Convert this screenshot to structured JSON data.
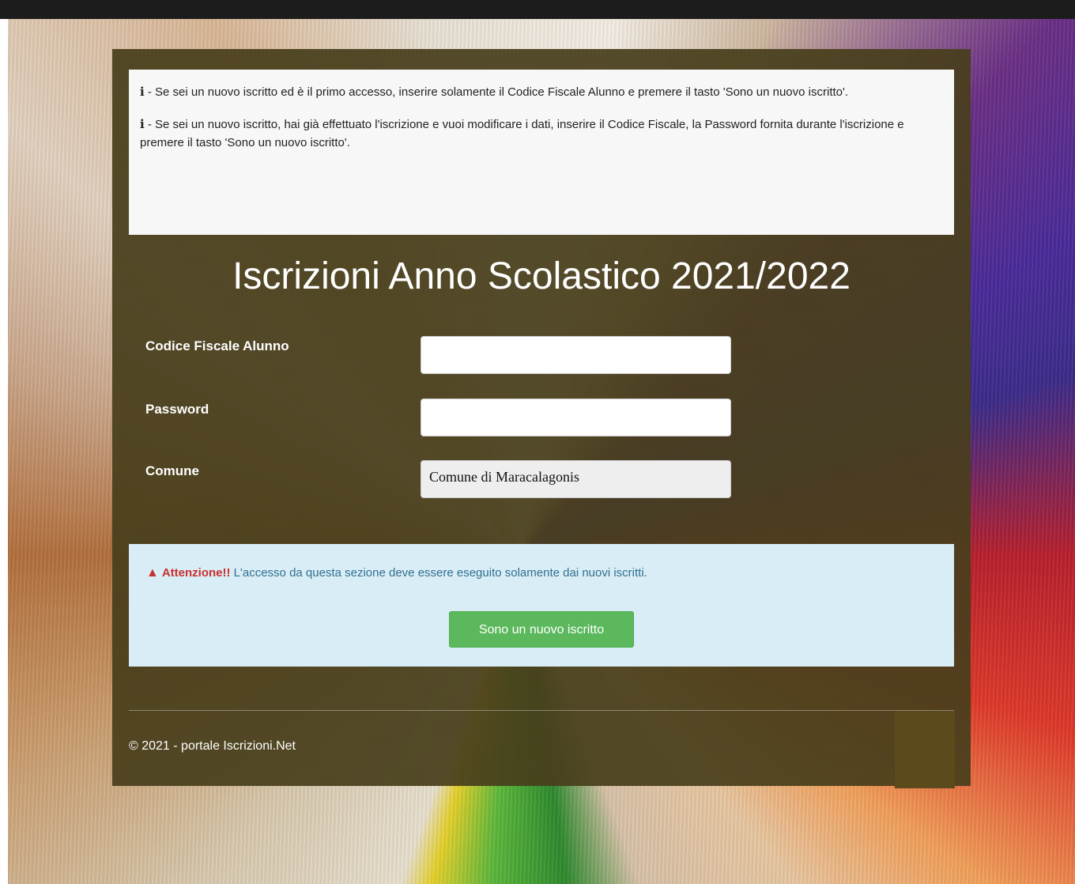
{
  "info": {
    "line1_prefix": "i",
    "line1_text": " - Se sei un nuovo iscritto ed è il primo accesso, inserire solamente il Codice Fiscale Alunno e premere il tasto 'Sono un nuovo iscritto'.",
    "line2_prefix": "i",
    "line2_text": " - Se sei un nuovo iscritto, hai già effettuato l'iscrizione e vuoi modificare i dati, inserire il Codice Fiscale, la Password fornita durante l'iscrizione e premere il tasto 'Sono un nuovo iscritto'."
  },
  "title": "Iscrizioni Anno Scolastico 2021/2022",
  "form": {
    "codice_label": "Codice Fiscale Alunno",
    "codice_value": "",
    "password_label": "Password",
    "password_value": "",
    "comune_label": "Comune",
    "comune_value": "Comune di Maracalagonis"
  },
  "alert": {
    "strong": "Attenzione!!",
    "text": " L'accesso da questa sezione deve essere eseguito solamente dai nuovi iscritti.",
    "button_label": "Sono un nuovo iscritto"
  },
  "footer": {
    "text": "© 2021 - portale Iscrizioni.Net"
  },
  "colors": {
    "panel": "#483e1c",
    "button": "#5cb85c",
    "alert_bg": "#d9edf7",
    "alert_text": "#31708f",
    "warning": "#c9302c"
  }
}
